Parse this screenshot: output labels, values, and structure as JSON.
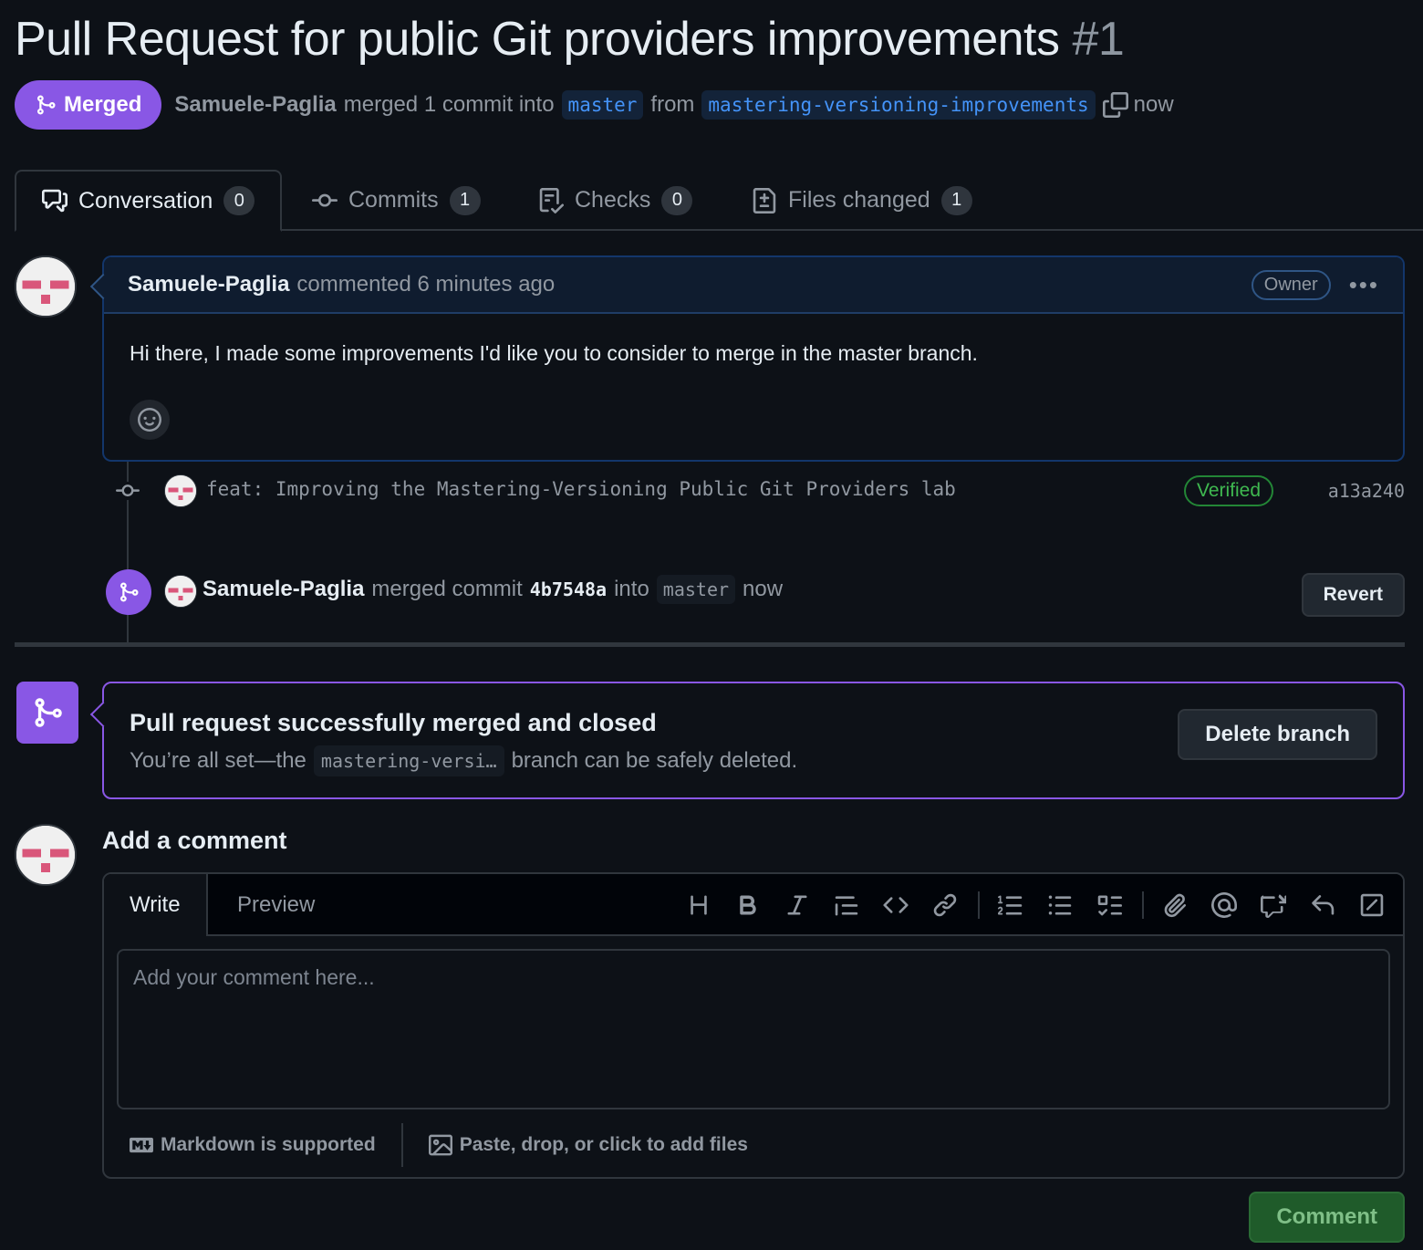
{
  "pr": {
    "title": "Pull Request for public Git providers improvements",
    "number": "#1",
    "state_label": "Merged",
    "author": "Samuele-Paglia",
    "merge_text": "merged 1 commit into",
    "base_branch": "master",
    "from_text": "from",
    "head_branch": "mastering-versioning-improvements",
    "time": "now"
  },
  "tabs": [
    {
      "label": "Conversation",
      "count": "0"
    },
    {
      "label": "Commits",
      "count": "1"
    },
    {
      "label": "Checks",
      "count": "0"
    },
    {
      "label": "Files changed",
      "count": "1"
    }
  ],
  "comment": {
    "author": "Samuele-Paglia",
    "action": "commented 6 minutes ago",
    "badge": "Owner",
    "body": "Hi there, I made some improvements I'd like you to consider to merge in the master branch."
  },
  "commit": {
    "message": "feat: Improving the Mastering-Versioning Public Git Providers lab",
    "verified_label": "Verified",
    "sha": "a13a240"
  },
  "merge_event": {
    "author": "Samuele-Paglia",
    "text": "merged commit",
    "sha": "4b7548a",
    "into_text": "into",
    "branch": "master",
    "time": "now",
    "revert_label": "Revert"
  },
  "merged_box": {
    "title": "Pull request successfully merged and closed",
    "sub_prefix": "You’re all set—the",
    "branch_short": "mastering-versi…",
    "sub_suffix": "branch can be safely deleted.",
    "delete_label": "Delete branch"
  },
  "add_comment": {
    "title": "Add a comment",
    "write_tab": "Write",
    "preview_tab": "Preview",
    "placeholder": "Add your comment here...",
    "markdown_note": "Markdown is supported",
    "files_note": "Paste, drop, or click to add files",
    "submit_label": "Comment"
  },
  "toolbar_icons": [
    "heading-icon",
    "bold-icon",
    "italic-icon",
    "quote-icon",
    "code-icon",
    "link-icon",
    "numbered-list-icon",
    "unordered-list-icon",
    "task-list-icon",
    "attach-icon",
    "mention-icon",
    "reference-icon",
    "undo-icon",
    "slash-command-icon"
  ],
  "colors": {
    "background": "#0d1117",
    "merged_purple": "#8957e5",
    "accent_blue": "#4493f8",
    "verified_green": "#3fb950",
    "comment_green": "#1f5b2a"
  }
}
